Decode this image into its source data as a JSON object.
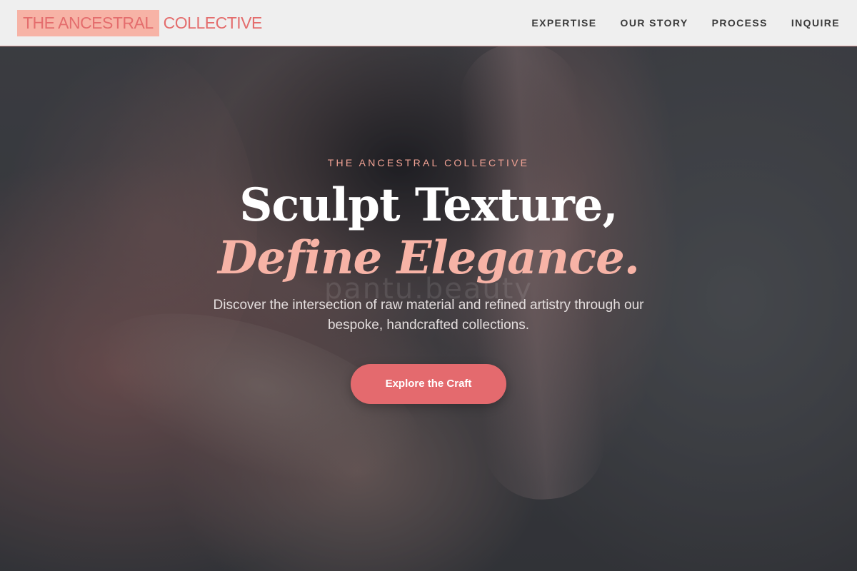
{
  "header": {
    "logo_part_1": "THE ANCESTRAL",
    "logo_part_2": "COLLECTIVE",
    "nav": [
      {
        "label": "EXPERTISE"
      },
      {
        "label": "OUR STORY"
      },
      {
        "label": "PROCESS"
      },
      {
        "label": "INQUIRE"
      }
    ]
  },
  "hero": {
    "eyebrow": "THE ANCESTRAL COLLECTIVE",
    "headline_line_1": "Sculpt Texture,",
    "headline_line_2": "Define Elegance.",
    "subtext": "Discover the intersection of raw material and refined artistry through our bespoke, handcrafted collections.",
    "cta_label": "Explore the Craft",
    "watermark": "pantu.beauty"
  },
  "colors": {
    "accent": "#e46a6e",
    "accent_light": "#f7b3a6",
    "nav_text": "#3a3a3a",
    "header_bg": "#efefef"
  }
}
